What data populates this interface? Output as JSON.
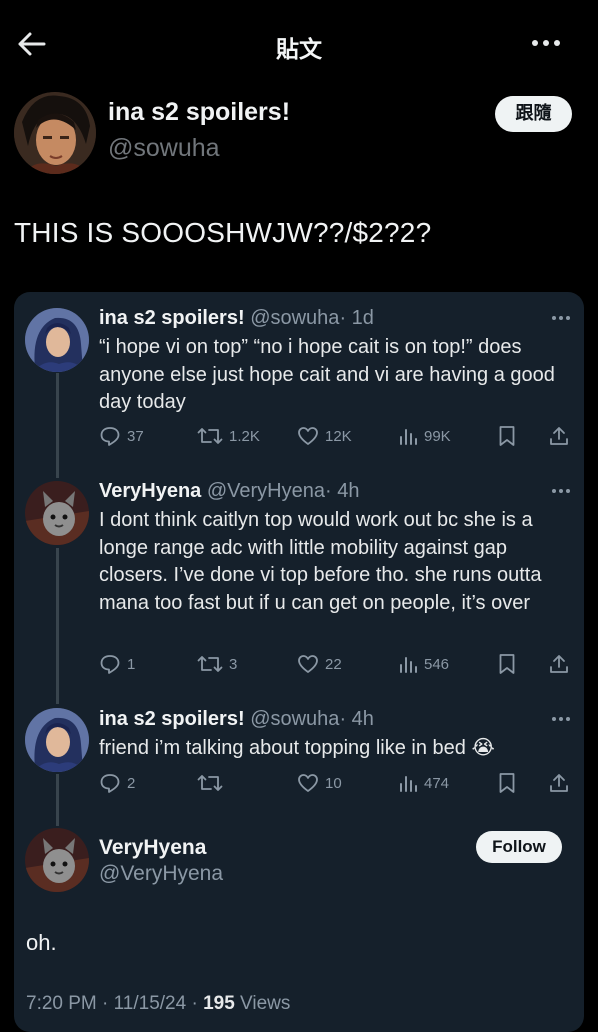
{
  "header": {
    "title": "貼文",
    "back_icon": "arrow-left-icon",
    "more_icon": "more-horizontal-icon"
  },
  "post": {
    "author_name": "ina s2 spoilers!",
    "author_handle": "@sowuha",
    "follow_label": "跟隨",
    "text": "THIS IS SOOOSHWJW??/$2?2?"
  },
  "thread": [
    {
      "name": "ina s2 spoilers!",
      "handle": "@sowuha",
      "time": "· 1d",
      "text": "“i hope vi on top” “no i hope cait is on top!” does anyone else just hope cait and vi are having a good day today",
      "replies": "37",
      "reposts": "1.2K",
      "likes": "12K",
      "views": "99K"
    },
    {
      "name": "VeryHyena",
      "handle": "@VeryHyena",
      "time": "· 4h",
      "text": "I dont think caitlyn top would work out bc she is a longe range adc with little mobility against gap closers. I’ve done vi top before tho. she runs outta mana too fast but if u can get on people, it’s over",
      "replies": "1",
      "reposts": "3",
      "likes": "22",
      "views": "546"
    },
    {
      "name": "ina s2 spoilers!",
      "handle": "@sowuha",
      "time": "· 4h",
      "text": "friend i’m talking about topping like in bed 😭",
      "replies": "2",
      "reposts": "",
      "likes": "10",
      "views": "474"
    }
  ],
  "quoted": {
    "name": "VeryHyena",
    "handle": "@VeryHyena",
    "follow_label": "Follow",
    "text": "oh.",
    "timestamp": "7:20 PM · 11/15/24 · ",
    "views_count": "195",
    "views_label": " Views"
  },
  "colors": {
    "background": "#000000",
    "card": "#15202b",
    "muted": "#8b98a5",
    "text": "#e7e9ea"
  }
}
